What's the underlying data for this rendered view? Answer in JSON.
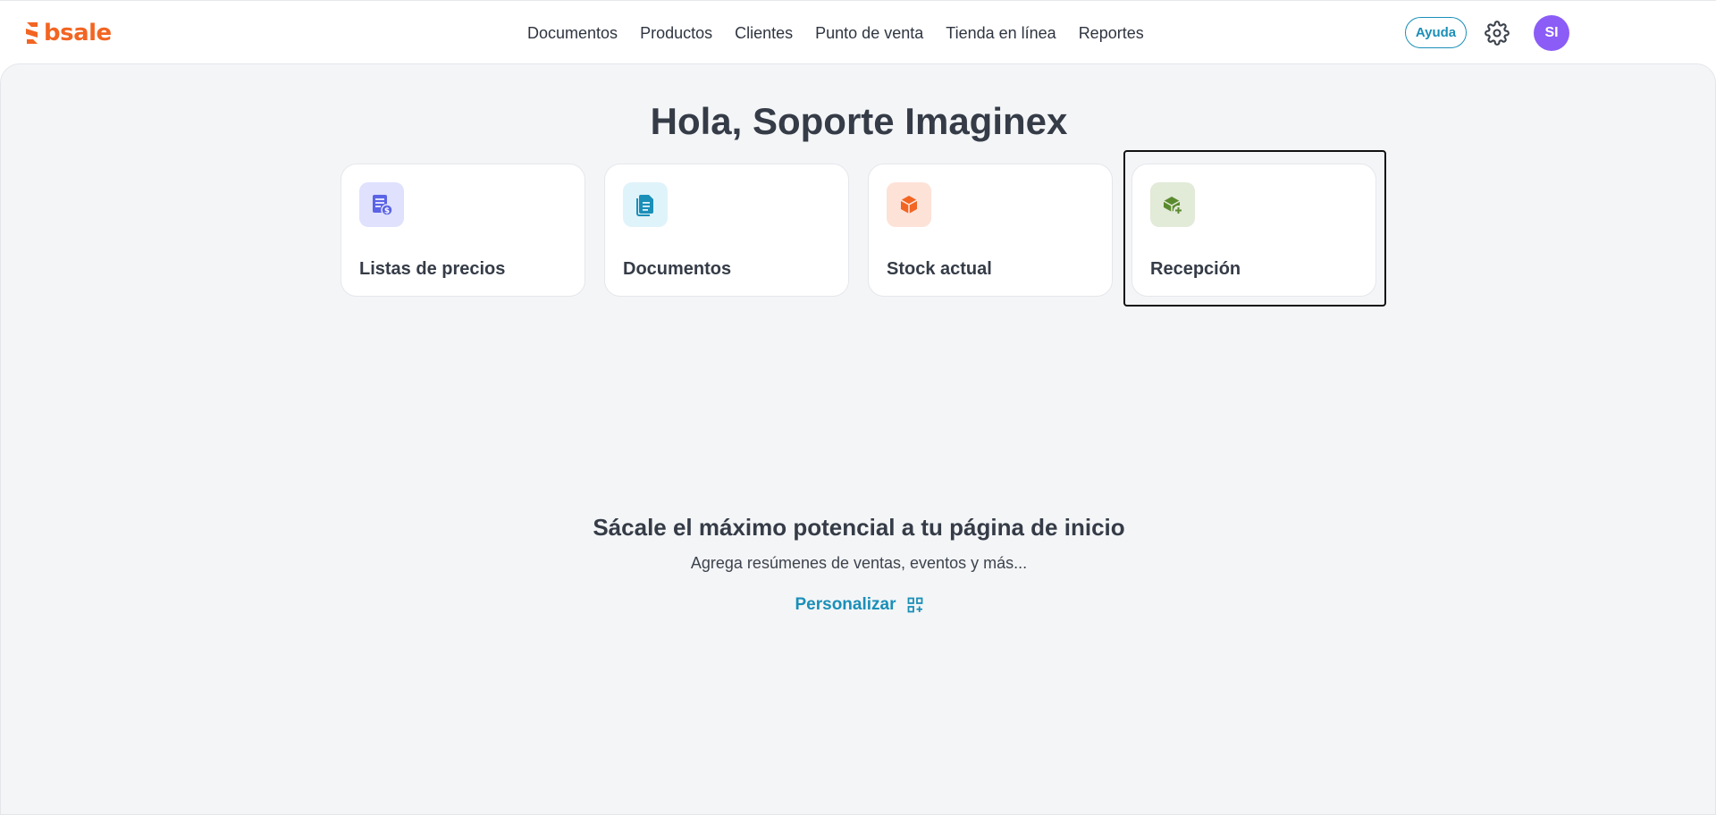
{
  "brand": {
    "name": "bsale",
    "color": "#f26522",
    "icon": "bsale-logo-icon"
  },
  "nav": {
    "items": [
      {
        "label": "Documentos"
      },
      {
        "label": "Productos"
      },
      {
        "label": "Clientes"
      },
      {
        "label": "Punto de venta"
      },
      {
        "label": "Tienda en línea"
      },
      {
        "label": "Reportes"
      }
    ]
  },
  "header": {
    "help_label": "Ayuda",
    "settings_icon": "gear-icon",
    "avatar_initials": "SI",
    "avatar_color": "#8b5cf6",
    "accent_color": "#1a8fb8"
  },
  "greeting": "Hola, Soporte Imaginex",
  "shortcuts": [
    {
      "label": "Listas de precios",
      "icon": "price-list-icon",
      "icon_bg": "#dfe1fd",
      "icon_color": "#5b63e6"
    },
    {
      "label": "Documentos",
      "icon": "document-icon",
      "icon_bg": "#dff3fa",
      "icon_color": "#1a8fb8"
    },
    {
      "label": "Stock actual",
      "icon": "box-icon",
      "icon_bg": "#fde2d8",
      "icon_color": "#f26522"
    },
    {
      "label": "Recepción",
      "icon": "box-add-icon",
      "icon_bg": "#e2ead8",
      "icon_color": "#5a8a2e",
      "focused": true
    }
  ],
  "promo": {
    "title": "Sácale el máximo potencial a tu página de inicio",
    "subtitle": "Agrega resúmenes de ventas, eventos y más...",
    "link_label": "Personalizar",
    "link_icon": "grid-add-icon"
  }
}
